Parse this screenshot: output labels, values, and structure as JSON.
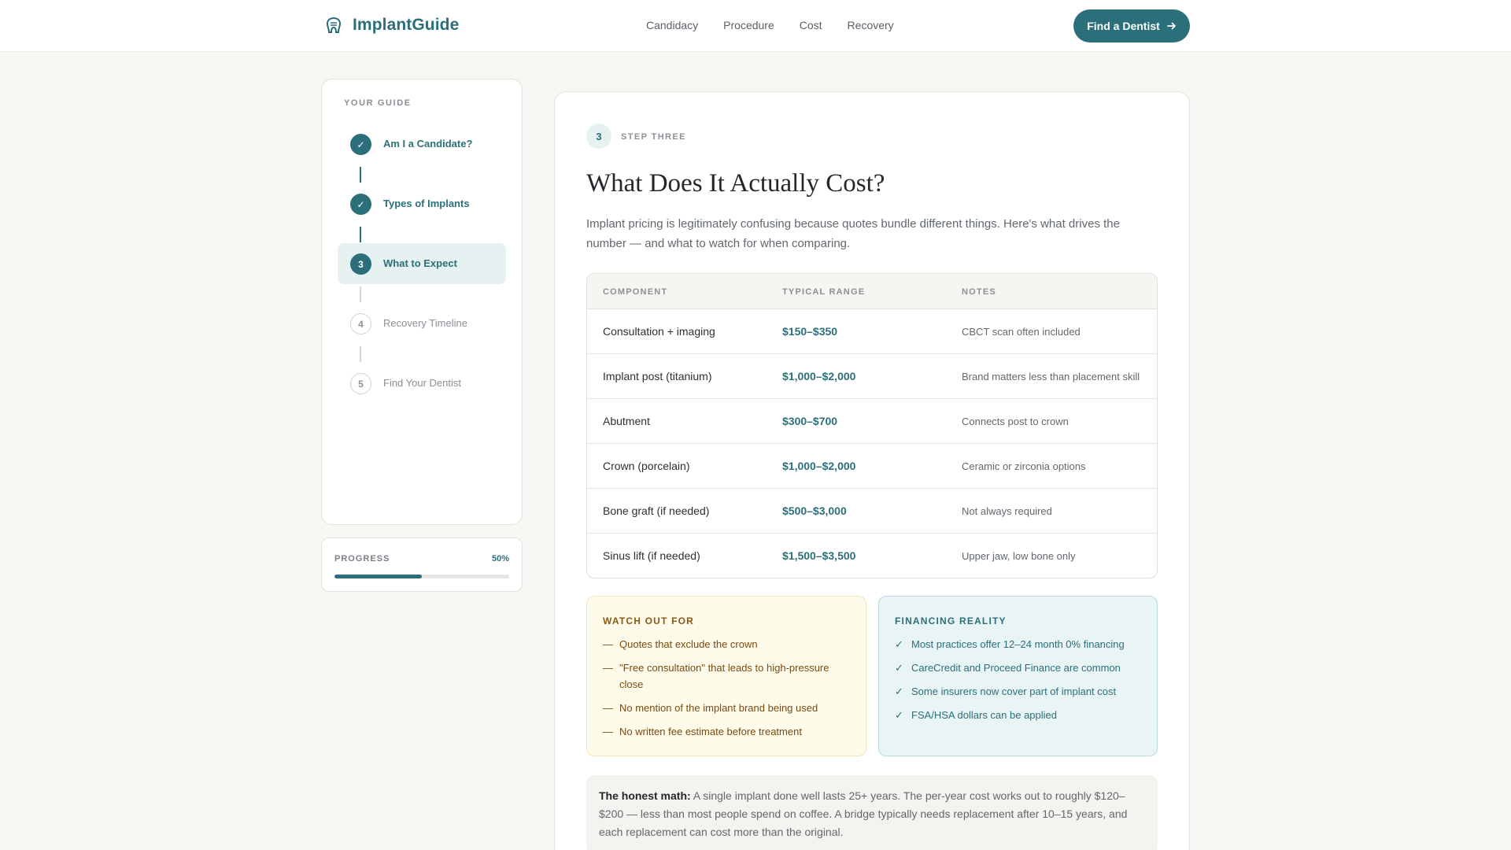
{
  "header": {
    "brand": "ImplantGuide",
    "nav": [
      "Candidacy",
      "Procedure",
      "Cost",
      "Recovery"
    ],
    "cta_label": "Find a Dentist"
  },
  "sidebar": {
    "title": "YOUR GUIDE",
    "steps": [
      {
        "marker": "✓",
        "label": "Am I a Candidate?",
        "state": "done"
      },
      {
        "marker": "✓",
        "label": "Types of Implants",
        "state": "done"
      },
      {
        "marker": "3",
        "label": "What to Expect",
        "state": "current"
      },
      {
        "marker": "4",
        "label": "Recovery Timeline",
        "state": "todo"
      },
      {
        "marker": "5",
        "label": "Find Your Dentist",
        "state": "todo"
      }
    ],
    "progress": {
      "label": "PROGRESS",
      "value": "50%",
      "fraction": 0.5
    }
  },
  "main": {
    "step_number": "3",
    "step_eyebrow": "STEP THREE",
    "title": "What Does It Actually Cost?",
    "intro": "Implant pricing is legitimately confusing because quotes bundle different things. Here's what drives the number — and what to watch for when comparing.",
    "table": {
      "headers": [
        "COMPONENT",
        "TYPICAL RANGE",
        "NOTES"
      ],
      "rows": [
        [
          "Consultation + imaging",
          "$150–$350",
          "CBCT scan often included"
        ],
        [
          "Implant post (titanium)",
          "$1,000–$2,000",
          "Brand matters less than placement skill"
        ],
        [
          "Abutment",
          "$300–$700",
          "Connects post to crown"
        ],
        [
          "Crown (porcelain)",
          "$1,000–$2,000",
          "Ceramic or zirconia options"
        ],
        [
          "Bone graft (if needed)",
          "$500–$3,000",
          "Not always required"
        ],
        [
          "Sinus lift (if needed)",
          "$1,500–$3,500",
          "Upper jaw, low bone only"
        ]
      ]
    },
    "watch_out": {
      "title": "WATCH OUT FOR",
      "marker": "—",
      "items": [
        "Quotes that exclude the crown",
        "\"Free consultation\" that leads to high-pressure close",
        "No mention of the implant brand being used",
        "No written fee estimate before treatment"
      ]
    },
    "financing": {
      "title": "FINANCING REALITY",
      "marker": "✓",
      "items": [
        "Most practices offer 12–24 month 0% financing",
        "CareCredit and Proceed Finance are common",
        "Some insurers now cover part of implant cost",
        "FSA/HSA dollars can be applied"
      ]
    },
    "honest_math": {
      "lead": "The honest math:",
      "text": " A single implant done well lasts 25+ years. The per-year cost works out to roughly $120–$200 — less than most people spend on coffee. A bridge typically needs replacement after 10–15 years, and each replacement can cost more than the original."
    }
  },
  "colors": {
    "accent": "#2b6f7a",
    "warning_bg": "#fefbeb",
    "info_bg": "#e9f4f5"
  }
}
